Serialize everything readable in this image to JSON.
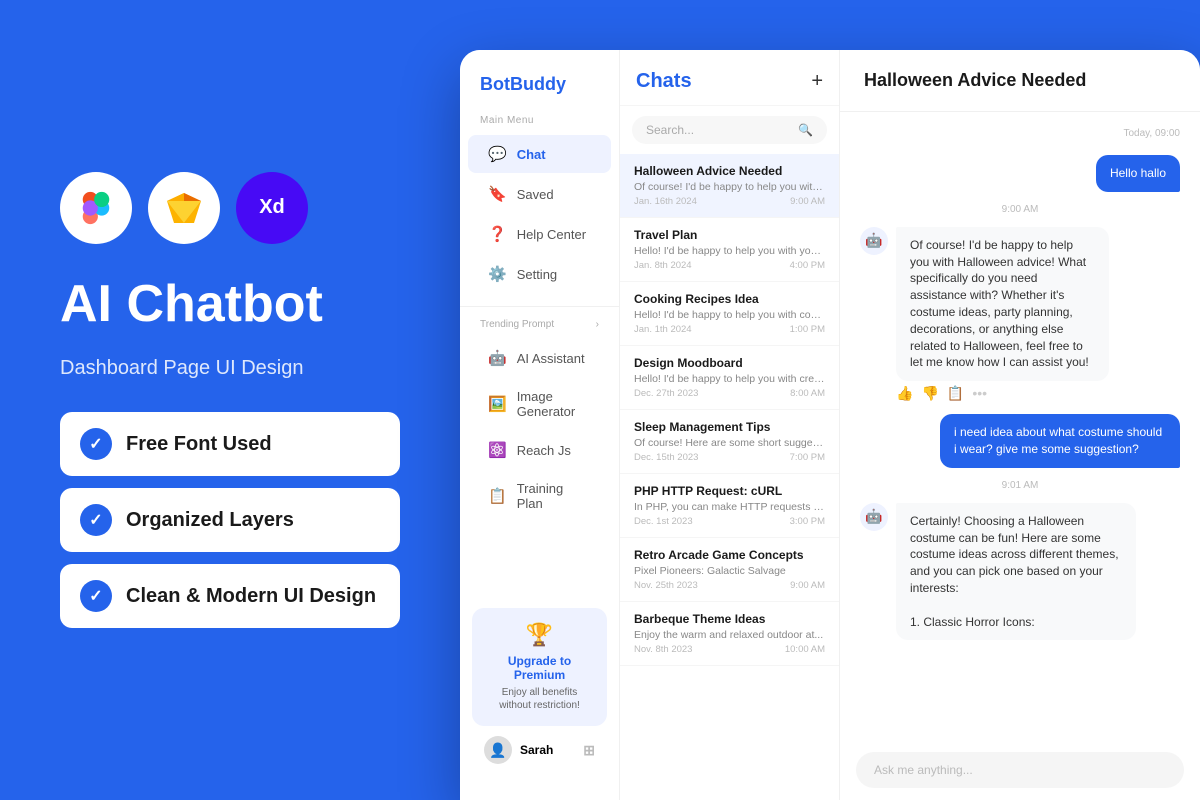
{
  "left": {
    "title": "AI Chatbot",
    "subtitle": "Dashboard Page UI Design",
    "badges": [
      {
        "label": "Free Font Used"
      },
      {
        "label": "Organized Layers"
      },
      {
        "label": "Clean & Modern UI Design"
      }
    ]
  },
  "sidebar": {
    "logo": "BotBuddy",
    "main_menu_label": "Main Menu",
    "items": [
      {
        "label": "Chat",
        "active": true
      },
      {
        "label": "Saved",
        "active": false
      },
      {
        "label": "Help Center",
        "active": false
      },
      {
        "label": "Setting",
        "active": false
      }
    ],
    "trending_label": "Trending Prompt",
    "trending_items": [
      {
        "label": "AI Assistant"
      },
      {
        "label": "Image Generator"
      },
      {
        "label": "Reach Js"
      },
      {
        "label": "Training Plan"
      }
    ],
    "upgrade_card": {
      "title": "Upgrade to Premium",
      "desc": "Enjoy all benefits without restriction!"
    },
    "user": "Sarah"
  },
  "chat_list": {
    "title": "Chats",
    "search_placeholder": "Search...",
    "items": [
      {
        "name": "Halloween Advice Needed",
        "preview": "Of course! I'd be happy to help you with...",
        "date": "Jan. 16th 2024",
        "time": "9:00 AM",
        "active": true
      },
      {
        "name": "Travel Plan",
        "preview": "Hello! I'd be happy to help you with your...",
        "date": "Jan. 8th 2024",
        "time": "4:00 PM",
        "active": false
      },
      {
        "name": "Cooking Recipes Idea",
        "preview": "Hello! I'd be happy to help you with coo...",
        "date": "Jan. 1th 2024",
        "time": "1:00 PM",
        "active": false
      },
      {
        "name": "Design Moodboard",
        "preview": "Hello! I'd be happy to help you with crea...",
        "date": "Dec. 27th 2023",
        "time": "8:00 AM",
        "active": false
      },
      {
        "name": "Sleep Management Tips",
        "preview": "Of course! Here are some short suggest...",
        "date": "Dec. 15th 2023",
        "time": "7:00 PM",
        "active": false
      },
      {
        "name": "PHP HTTP Request: cURL",
        "preview": "In PHP, you can make HTTP requests usi...",
        "date": "Dec. 1st 2023",
        "time": "3:00 PM",
        "active": false
      },
      {
        "name": "Retro Arcade Game Concepts",
        "preview": "Pixel Pioneers: Galactic Salvage",
        "date": "Nov. 25th 2023",
        "time": "9:00 AM",
        "active": false
      },
      {
        "name": "Barbeque Theme Ideas",
        "preview": "Enjoy the warm and relaxed outdoor at...",
        "date": "Nov. 8th 2023",
        "time": "10:00 AM",
        "active": false
      }
    ]
  },
  "chat_area": {
    "title": "Halloween Advice Needed",
    "date_divider": "Today, 09:00",
    "messages": [
      {
        "type": "user",
        "text": "Hello hallo",
        "time": "9:00 AM"
      },
      {
        "type": "bot",
        "text": "Of course! I'd be happy to help you with Halloween advice! What specifically do you need assistance with? Whether it's costume ideas, party planning, decorations, or anything else related to Halloween, feel free to let me know how I can assist you!",
        "time": ""
      },
      {
        "type": "user",
        "text": "i need idea about what costume should i wear? give me some suggestion?",
        "time": "9:01 AM"
      },
      {
        "type": "bot",
        "text": "Certainly! Choosing a Halloween costume can be fun! Here are some costume ideas across different themes, and you can pick one based on your interests:\n\n1. Classic Horror Icons:",
        "time": ""
      }
    ],
    "input_placeholder": "Ask me anything..."
  }
}
